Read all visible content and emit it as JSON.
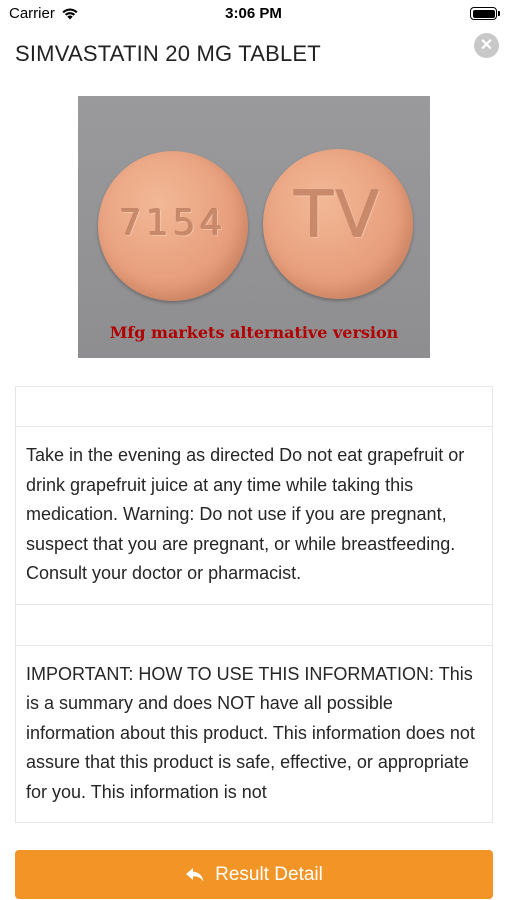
{
  "status_bar": {
    "carrier": "Carrier",
    "time": "3:06 PM"
  },
  "header": {
    "title": "SIMVASTATIN 20 MG TABLET",
    "close_icon": "close-circle-icon"
  },
  "pill_image": {
    "left_imprint": "7154",
    "right_imprint": "TV",
    "caption": "Mfg markets alternative version",
    "pill_color": "#e8a07e"
  },
  "sections": [
    {
      "heading": "",
      "text": "Take in the evening as directed Do not eat grapefruit or drink grapefruit juice at any time while taking this medication. Warning: Do not use if you are pregnant, suspect that you are pregnant, or while breastfeeding. Consult your doctor or pharmacist."
    },
    {
      "heading": "",
      "text": "IMPORTANT: HOW TO USE THIS INFORMATION: This is a summary and does NOT have all possible information about this product. This information does not assure that this product is safe, effective, or appropriate for you. This information is not"
    }
  ],
  "footer": {
    "button_label": "Result Detail",
    "button_icon": "reply-arrow-icon",
    "accent_color": "#f39526"
  }
}
